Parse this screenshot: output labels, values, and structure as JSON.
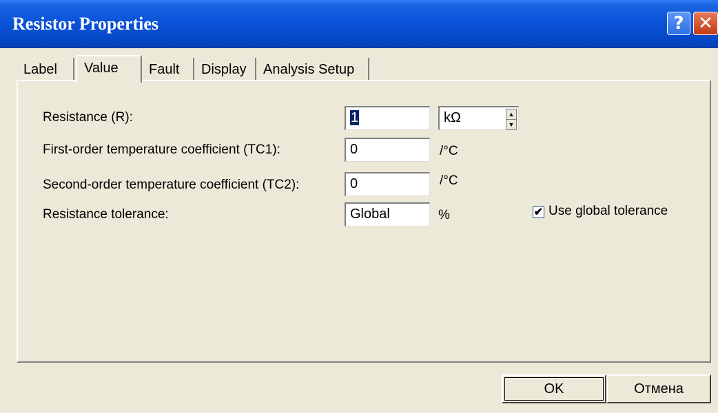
{
  "window": {
    "title": "Resistor Properties",
    "help_glyph": "?",
    "close_glyph": "✕"
  },
  "tabs": [
    {
      "label": "Label",
      "active": false
    },
    {
      "label": "Value",
      "active": true
    },
    {
      "label": "Fault",
      "active": false
    },
    {
      "label": "Display",
      "active": false
    },
    {
      "label": "Analysis Setup",
      "active": false
    }
  ],
  "form": {
    "resistance_label": "Resistance (R):",
    "resistance_value": "1",
    "resistance_unit": "kΩ",
    "tc1_label": "First-order temperature coefficient (TC1):",
    "tc1_value": "0",
    "tc1_unit": "/°C",
    "tc2_label": "Second-order temperature coefficient (TC2):",
    "tc2_value": "0",
    "tc2_unit": "/°C",
    "tolerance_label": "Resistance tolerance:",
    "tolerance_value": "Global",
    "tolerance_unit": "%",
    "use_global_tolerance_label": "Use global tolerance",
    "use_global_tolerance_checked": true,
    "check_glyph": "✔"
  },
  "buttons": {
    "ok": "OK",
    "cancel": "Отмена"
  },
  "colors": {
    "titlebar": "#0a52d9",
    "dialog_bg": "#ece9d8",
    "selection": "#0a246a"
  }
}
